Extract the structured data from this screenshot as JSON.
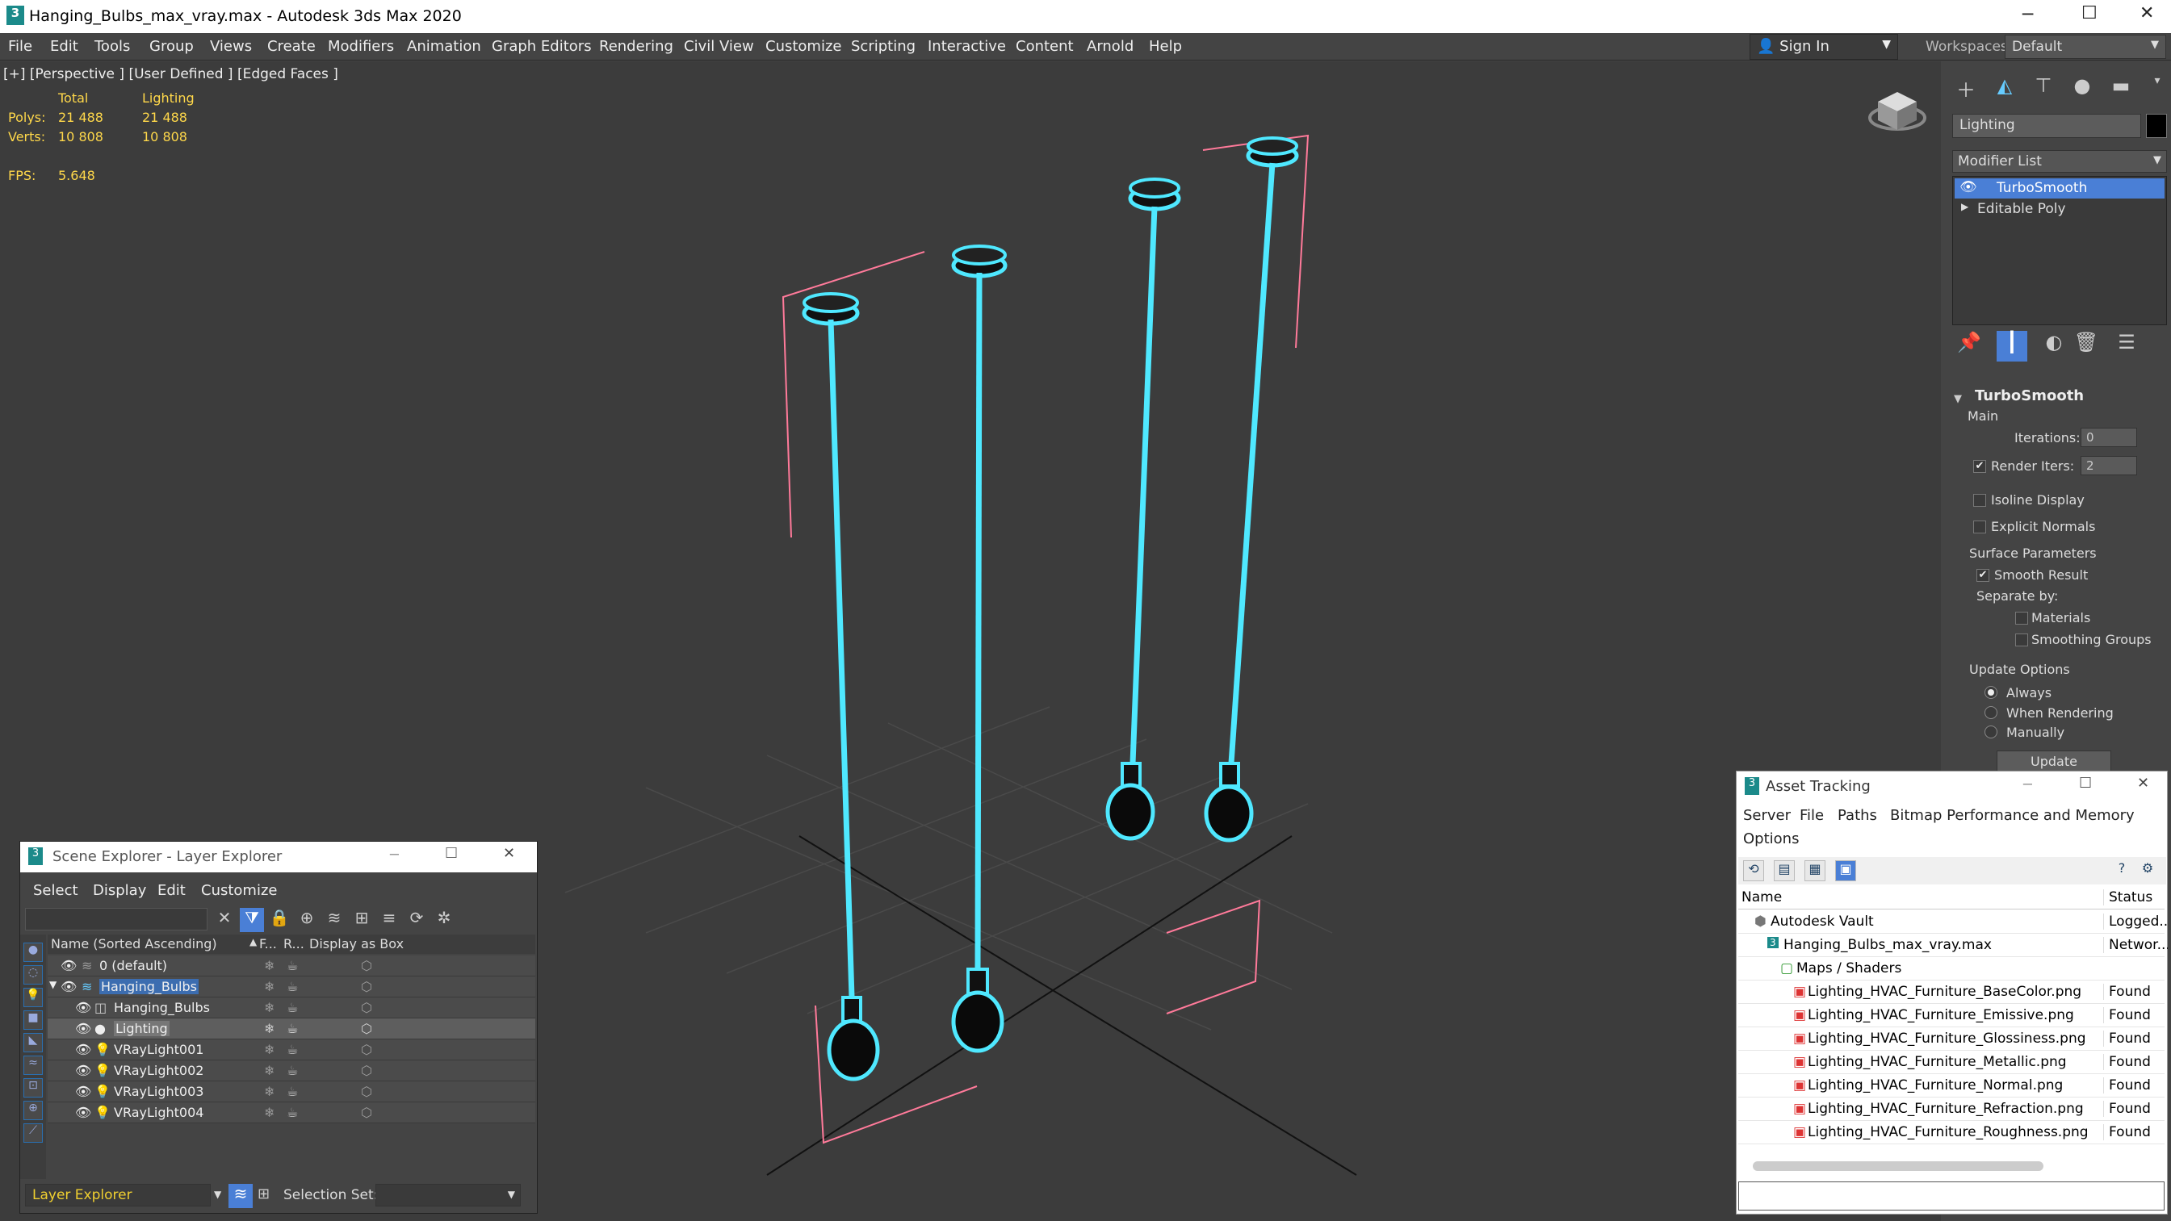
{
  "window": {
    "title": "Hanging_Bulbs_max_vray.max - Autodesk 3ds Max 2020"
  },
  "menu": [
    "File",
    "Edit",
    "Tools",
    "Group",
    "Views",
    "Create",
    "Modifiers",
    "Animation",
    "Graph Editors",
    "Rendering",
    "Civil View",
    "Customize",
    "Scripting",
    "Interactive",
    "Content",
    "Arnold",
    "Help"
  ],
  "account": {
    "sign_in": "Sign In",
    "workspaces_label": "Workspaces:",
    "workspace": "Default"
  },
  "viewport": {
    "label": "[+] [Perspective ] [User Defined ] [Edged Faces ]",
    "stats": {
      "col_total": "Total",
      "col_lighting": "Lighting",
      "polys_label": "Polys:",
      "polys_total": "21 488",
      "polys_lighting": "21 488",
      "verts_label": "Verts:",
      "verts_total": "10 808",
      "verts_lighting": "10 808",
      "fps_label": "FPS:",
      "fps": "5.648"
    }
  },
  "colors": {
    "wire": "#4fe8ff",
    "selection": "#ff7a9a",
    "panel": "#444444",
    "highlight": "#4a7fd6"
  },
  "command_panel": {
    "object_name": "Lighting",
    "modifier_list": "Modifier List",
    "stack": [
      "TurboSmooth",
      "Editable Poly"
    ],
    "turbosmooth": {
      "title": "TurboSmooth",
      "main": "Main",
      "iterations_label": "Iterations:",
      "iterations": "0",
      "render_iters_label": "Render Iters:",
      "render_iters": "2",
      "isoline": "Isoline Display",
      "explicit": "Explicit Normals",
      "surface": "Surface Parameters",
      "smooth_result": "Smooth Result",
      "separate_by": "Separate by:",
      "materials": "Materials",
      "smoothing_groups": "Smoothing Groups",
      "update_options": "Update Options",
      "always": "Always",
      "when_rendering": "When Rendering",
      "manually": "Manually",
      "update_button": "Update"
    }
  },
  "scene_explorer": {
    "title": "Scene Explorer - Layer Explorer",
    "menu": [
      "Select",
      "Display",
      "Edit",
      "Customize"
    ],
    "columns": {
      "name": "Name (Sorted Ascending)",
      "f": "F...",
      "r": "R...",
      "box": "Display as Box"
    },
    "rows": [
      "0 (default)",
      "Hanging_Bulbs",
      "Hanging_Bulbs",
      "Lighting",
      "VRayLight001",
      "VRayLight002",
      "VRayLight003",
      "VRayLight004"
    ],
    "footer_dropdown": "Layer Explorer",
    "selection_set": "Selection Set:"
  },
  "asset_tracking": {
    "title": "Asset Tracking",
    "menu": [
      "Server",
      "File",
      "Paths",
      "Bitmap Performance and Memory",
      "Options"
    ],
    "columns": {
      "name": "Name",
      "status": "Status"
    },
    "rows": [
      {
        "name": "Autodesk Vault",
        "status": "Logged..."
      },
      {
        "name": "Hanging_Bulbs_max_vray.max",
        "status": "Networ..."
      },
      {
        "name": "Maps / Shaders",
        "status": ""
      },
      {
        "name": "Lighting_HVAC_Furniture_BaseColor.png",
        "status": "Found"
      },
      {
        "name": "Lighting_HVAC_Furniture_Emissive.png",
        "status": "Found"
      },
      {
        "name": "Lighting_HVAC_Furniture_Glossiness.png",
        "status": "Found"
      },
      {
        "name": "Lighting_HVAC_Furniture_Metallic.png",
        "status": "Found"
      },
      {
        "name": "Lighting_HVAC_Furniture_Normal.png",
        "status": "Found"
      },
      {
        "name": "Lighting_HVAC_Furniture_Refraction.png",
        "status": "Found"
      },
      {
        "name": "Lighting_HVAC_Furniture_Roughness.png",
        "status": "Found"
      }
    ]
  }
}
